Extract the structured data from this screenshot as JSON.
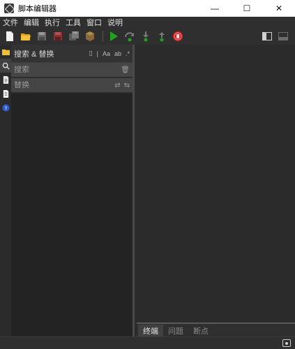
{
  "window": {
    "title": "脚本编辑器",
    "minimize": "—",
    "maximize": "☐",
    "close": "✕"
  },
  "menu": [
    "文件",
    "编辑",
    "执行",
    "工具",
    "窗口",
    "说明"
  ],
  "toolbar": {
    "icons": [
      "new-file-icon",
      "open-folder-icon",
      "save-icon",
      "save-as-icon",
      "save-all-icon",
      "package-icon",
      "run-icon",
      "step-over-icon",
      "step-into-icon",
      "step-out-icon",
      "stop-icon"
    ],
    "right_icons": [
      "toggle-left-panel-icon",
      "toggle-bottom-panel-icon"
    ]
  },
  "sidebar_strip": [
    "folder-icon",
    "search-icon",
    "script-icon",
    "document-icon",
    "help-icon"
  ],
  "search_panel": {
    "title": "搜索 & 替换",
    "header_icons": [
      "page-icon",
      "separator",
      "Aa",
      "word-match-icon",
      "regex-icon"
    ],
    "search_placeholder": "搜索",
    "replace_placeholder": "替换"
  },
  "bottom_tabs": [
    {
      "label": "终端",
      "active": true
    },
    {
      "label": "问题",
      "active": false
    },
    {
      "label": "断点",
      "active": false
    }
  ],
  "colors": {
    "background": "#2b2b2b",
    "panel": "#232323",
    "run_green": "#22a022",
    "stop_red": "#cc2222"
  }
}
